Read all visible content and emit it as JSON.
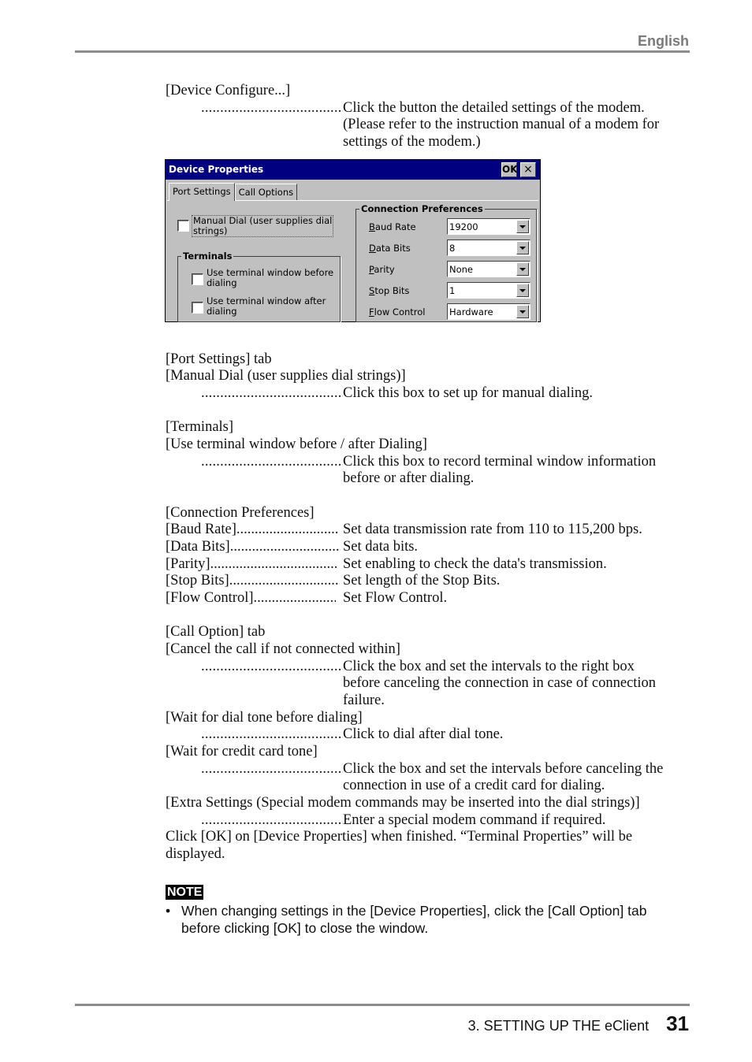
{
  "header": {
    "language": "English"
  },
  "footer": {
    "chapter": "3. SETTING UP THE eClient",
    "page": "31"
  },
  "device_configure": {
    "label": "[Device Configure...]",
    "desc_lines": [
      "Click the button the detailed settings of the modem.",
      "(Please refer to the instruction manual of a modem for",
      "settings of the modem.)"
    ]
  },
  "dialog": {
    "title": "Device Properties",
    "ok_label": "OK",
    "close_label": "×",
    "tabs": [
      {
        "label": "Port Settings",
        "active": true
      },
      {
        "label": "Call Options",
        "active": false
      }
    ],
    "manual_dial": {
      "label_line1": "Manual Dial (user supplies dial",
      "label_line2": "strings)",
      "checked": false
    },
    "terminals": {
      "title": "Terminals",
      "options": [
        {
          "line1": "Use terminal window before",
          "line2": "dialing",
          "checked": false
        },
        {
          "line1": "Use terminal window after",
          "line2": "dialing",
          "checked": false
        }
      ]
    },
    "connection": {
      "title": "Connection Preferences",
      "fields": [
        {
          "label": "Baud Rate",
          "value": "19200"
        },
        {
          "label": "Data Bits",
          "value": "8"
        },
        {
          "label": "Parity",
          "value": "None"
        },
        {
          "label": "Stop Bits",
          "value": "1"
        },
        {
          "label": "Flow Control",
          "value": "Hardware"
        }
      ]
    }
  },
  "port_settings": {
    "heading": "[Port Settings] tab",
    "manual_dial_label": "[Manual Dial (user supplies dial strings)]",
    "manual_dial_desc": "Click this box to set up for manual dialing.",
    "terminals_heading": "[Terminals]",
    "terminals_label": "[Use terminal window before / after Dialing]",
    "terminals_desc_lines": [
      "Click this box to record terminal window information",
      "before or after dialing."
    ]
  },
  "connection_prefs": {
    "heading": "[Connection Preferences]",
    "items": [
      {
        "label": "[Baud Rate]",
        "desc": "Set data transmission rate from 110 to 115,200 bps."
      },
      {
        "label": "[Data Bits]",
        "desc": "Set data bits."
      },
      {
        "label": "[Parity]",
        "desc": "Set enabling to check the data's transmission."
      },
      {
        "label": "[Stop Bits]",
        "desc": "Set length of the Stop Bits."
      },
      {
        "label": "[Flow Control]",
        "desc": "Set Flow Control."
      }
    ]
  },
  "call_option": {
    "heading": "[Call Option] tab",
    "cancel_label": "[Cancel the call if not connected within]",
    "cancel_desc_lines": [
      "Click the box and set the intervals to the right box",
      "before canceling the connection in case of connection",
      "failure."
    ],
    "wait_dial_label": "[Wait for dial tone before dialing]",
    "wait_dial_desc": "Click to dial after dial tone.",
    "wait_credit_label": "[Wait for credit card tone]",
    "wait_credit_desc_lines": [
      "Click the box and set the intervals before canceling the",
      "connection in use of a credit card for dialing."
    ],
    "extra_label": "[Extra Settings (Special modem commands may be inserted into the dial strings)]",
    "extra_desc": "Enter a special modem command if required.",
    "finish_lines": [
      "Click [OK] on [Device Properties] when finished.  “Terminal Properties” will be",
      "displayed."
    ]
  },
  "note": {
    "label": "NOTE",
    "bullet": "•",
    "text": "When changing settings in the [Device Properties], click the [Call Option] tab before clicking [OK] to close the window."
  },
  "leader_dots": ".................................................."
}
